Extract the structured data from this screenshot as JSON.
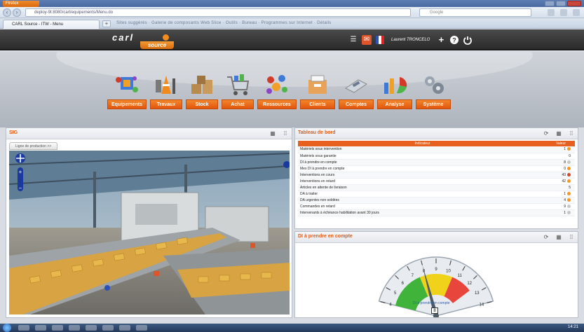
{
  "browser": {
    "menu_button": "Firefox",
    "url": "deploy-9t:8080/carl/equipements/Menu.do",
    "search_placeholder": "Google",
    "tab_title": "CARL Source - ITW - Menu",
    "new_tab": "+",
    "bookmarks": "Sites suggérés  ·  Galerie de composants Web Slice  ·  Outils  ·  Bureau  ·  Programmes sur Internet  ·  Détails"
  },
  "app": {
    "logo_top": "carl",
    "logo_bottom": "source",
    "user": "Laurent TRONCELO",
    "icons": [
      "menu-icon",
      "chat-icon",
      "flag-icon",
      "add-icon",
      "help-icon",
      "power-icon"
    ]
  },
  "modules": [
    {
      "label": "Equipements",
      "icon": "equipment-icon"
    },
    {
      "label": "Travaux",
      "icon": "works-icon"
    },
    {
      "label": "Stock",
      "icon": "stock-icon"
    },
    {
      "label": "Achat",
      "icon": "purchase-icon"
    },
    {
      "label": "Ressources",
      "icon": "resources-icon"
    },
    {
      "label": "Clients",
      "icon": "clients-icon"
    },
    {
      "label": "Comptes",
      "icon": "accounts-icon"
    },
    {
      "label": "Analyse",
      "icon": "analysis-icon"
    },
    {
      "label": "Système",
      "icon": "system-icon"
    }
  ],
  "sig": {
    "title": "SIG",
    "tab": "Ligne de production >>"
  },
  "dashboard": {
    "title": "Tableau de bord",
    "col_indicator": "Indicateur",
    "col_value": "Valeur",
    "rows": [
      {
        "label": "Matériels sous intervention",
        "value": "1",
        "status": "orange"
      },
      {
        "label": "Matériels sous garantie",
        "value": "0",
        "status": ""
      },
      {
        "label": "DI à prendre en compte",
        "value": "8",
        "status": "grey"
      },
      {
        "label": "Mes DI à prendre en compte",
        "value": "0",
        "status": "orange"
      },
      {
        "label": "Interventions en cours",
        "value": "43",
        "status": "red"
      },
      {
        "label": "Interventions en retard",
        "value": "42",
        "status": "orange"
      },
      {
        "label": "Articles en attente de livraison",
        "value": "5",
        "status": ""
      },
      {
        "label": "DA à traiter",
        "value": "1",
        "status": "orange"
      },
      {
        "label": "DA urgentes non soldées",
        "value": "4",
        "status": "orange"
      },
      {
        "label": "Commandes en retard",
        "value": "9",
        "status": "grey"
      },
      {
        "label": "Intervenants à échéance habilitation avant 30 jours",
        "value": "1",
        "status": "grey"
      }
    ]
  },
  "gauge_panel": {
    "title": "DI à prendre en compte",
    "caption": "DI à prendre en compte",
    "value": "8",
    "scale": [
      "4",
      "5",
      "6",
      "7",
      "8",
      "9",
      "10",
      "11",
      "12",
      "13",
      "14"
    ],
    "colors": {
      "green": "#3fb33a",
      "yellow": "#f0d21b",
      "red": "#e8453c"
    }
  },
  "taskbar": {
    "clock": "14:21"
  }
}
